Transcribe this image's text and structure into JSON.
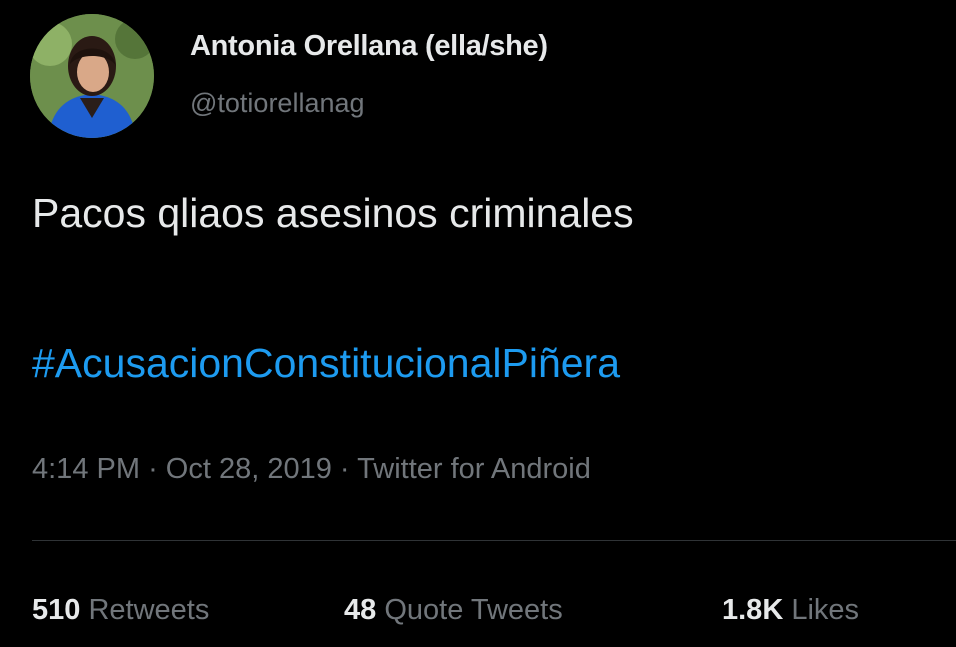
{
  "author": {
    "name": "Antonia Orellana (ella/she)",
    "handle": "@totiorellanag",
    "avatar_icon": "profile-photo"
  },
  "tweet": {
    "text": "Pacos qliaos asesinos criminales",
    "hashtag": "#AcusacionConstitucionalPiñera",
    "time": "4:14 PM",
    "separator": "·",
    "date": "Oct 28, 2019",
    "source": "Twitter for Android"
  },
  "stats": {
    "retweets_count": "510",
    "retweets_label": "Retweets",
    "quotes_count": "48",
    "quotes_label": "Quote Tweets",
    "likes_count": "1.8K",
    "likes_label": "Likes"
  },
  "colors": {
    "background": "#000000",
    "text": "#e7e9ea",
    "secondary": "#71767b",
    "link": "#1d9bf0",
    "divider": "#2f3336"
  }
}
